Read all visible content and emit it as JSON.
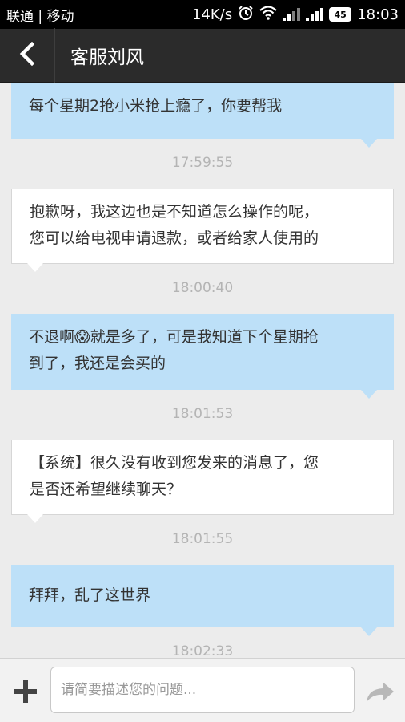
{
  "status_bar": {
    "carrier": "联通 | 移动",
    "speed": "14K/s",
    "battery": "45",
    "time": "18:03"
  },
  "header": {
    "title": "客服刘风",
    "back_icon": "chevron-left-icon"
  },
  "messages": [
    {
      "direction": "out",
      "text_lines": [
        "每个星期2抢小米抢上瘾了，你要帮我"
      ]
    },
    {
      "time": "17:59:55"
    },
    {
      "direction": "in",
      "text_lines": [
        "抱歉呀，我这边也是不知道怎么操作的呢，",
        "您可以给电视申请退款，或者给家人使用的"
      ]
    },
    {
      "time": "18:00:40"
    },
    {
      "direction": "out",
      "text_lines": [
        "不退啊😱就是多了，可是我知道下个星期抢",
        "到了，我还是会买的"
      ]
    },
    {
      "time": "18:01:53"
    },
    {
      "direction": "in",
      "text_lines": [
        "【系统】很久没有收到您发来的消息了，您",
        "是否还希望继续聊天？"
      ]
    },
    {
      "time": "18:01:55"
    },
    {
      "direction": "out",
      "text_lines": [
        "拜拜，乱了这世界"
      ]
    },
    {
      "time": "18:02:33"
    }
  ],
  "input_bar": {
    "placeholder": "请简要描述您的问题...",
    "value": "",
    "add_icon": "plus-icon",
    "send_icon": "send-arrow-icon"
  },
  "colors": {
    "outgoing_bubble": "#bde0f8",
    "incoming_bubble": "#ffffff",
    "header_bg": "#2b2b2b",
    "chat_bg": "#ececec"
  }
}
